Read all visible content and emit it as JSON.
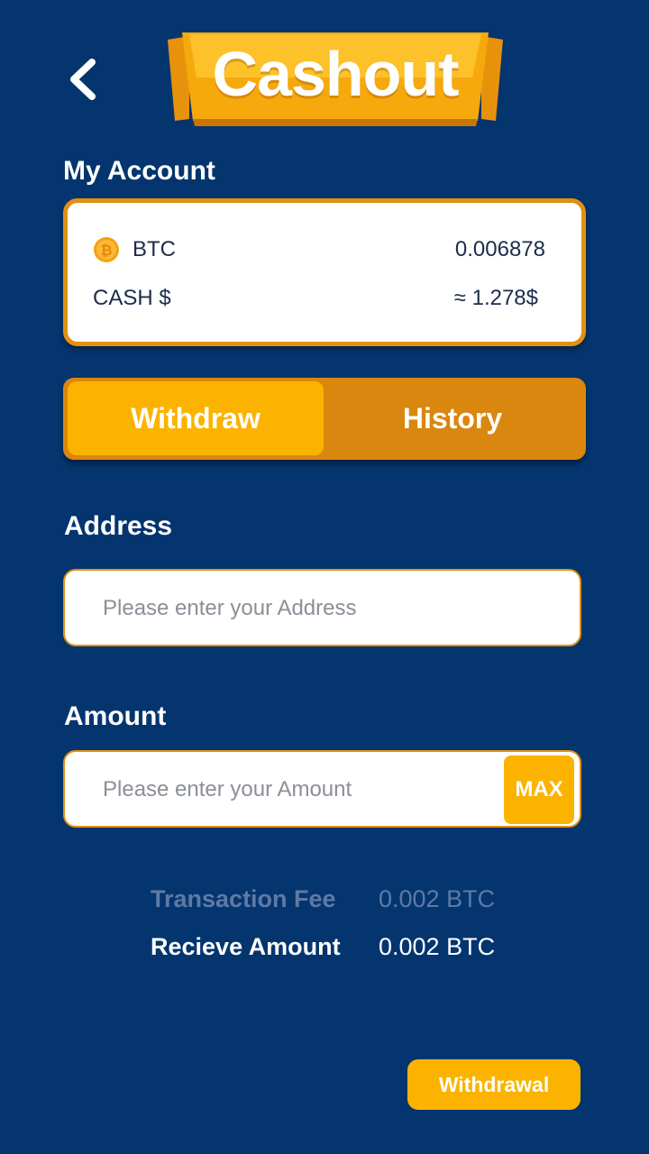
{
  "header": {
    "title": "Cashout",
    "back_icon": "chevron-left-icon"
  },
  "account": {
    "label": "My Account",
    "rows": [
      {
        "icon": "bitcoin-coin-icon",
        "name": "BTC",
        "value": "0.006878"
      },
      {
        "name": "CASH $",
        "value": "≈ 1.278$"
      }
    ]
  },
  "tabs": [
    {
      "label": "Withdraw",
      "active": true
    },
    {
      "label": "History",
      "active": false
    }
  ],
  "address": {
    "label": "Address",
    "value": "",
    "placeholder": "Please enter your Address"
  },
  "amount": {
    "label": "Amount",
    "value": "",
    "placeholder": "Please enter your Amount",
    "max_label": "MAX"
  },
  "summary": {
    "fee_label": "Transaction Fee",
    "fee_value": "0.002 BTC",
    "receive_label": "Recieve Amount",
    "receive_value": "0.002 BTC"
  },
  "actions": {
    "withdrawal_label": "Withdrawal"
  },
  "colors": {
    "background": "#04356e",
    "accent": "#fbb300",
    "accent_dark": "#d9870e",
    "card_border": "#e19012"
  }
}
